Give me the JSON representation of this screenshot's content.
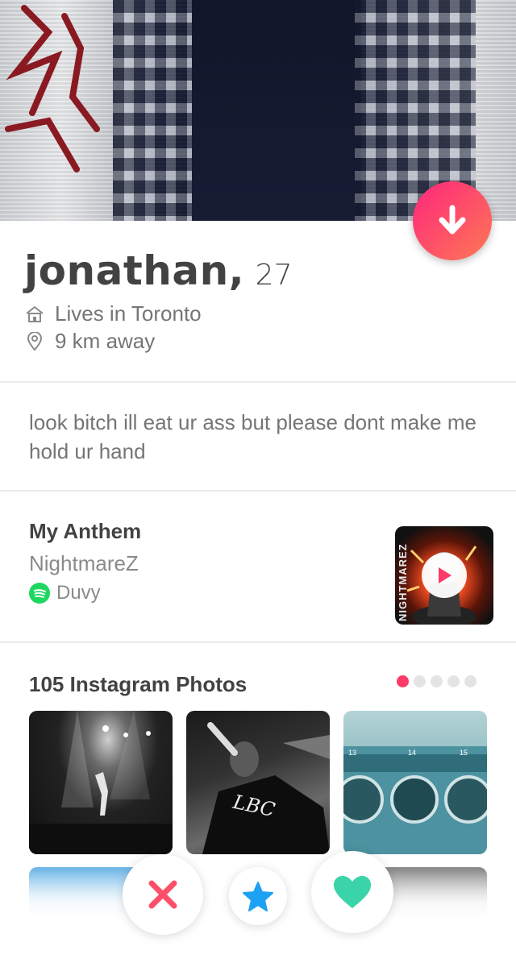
{
  "profile": {
    "name": "jonathan",
    "comma": ",",
    "age": "27",
    "lives_in": "Lives in Toronto",
    "distance": "9 km away",
    "bio": "look bitch ill eat ur ass but please dont make me hold ur hand"
  },
  "anthem": {
    "section_title": "My Anthem",
    "song": "NightmareZ",
    "artist": "Duvy",
    "album_art_text": "NIGHTMAREZ"
  },
  "instagram": {
    "section_title": "105 Instagram Photos",
    "page_count": 5,
    "active_page": 1,
    "photo_overlay_text": "LBC",
    "washer_numbers": [
      "13",
      "14",
      "15"
    ]
  },
  "actions": {
    "nope": "nope",
    "super_like": "super like",
    "like": "like"
  },
  "colors": {
    "brand_gradient_start": "#fd267d",
    "brand_gradient_end": "#ff7854",
    "nope": "#fd5068",
    "super_like": "#1da1f2",
    "like": "#3ad4a8",
    "spotify": "#1ed760"
  },
  "icons": {
    "collapse": "arrow-down-icon",
    "home": "home-icon",
    "location": "location-pin-icon",
    "spotify": "spotify-icon",
    "play": "play-icon",
    "nope": "x-icon",
    "super_like": "star-icon",
    "like": "heart-icon"
  }
}
